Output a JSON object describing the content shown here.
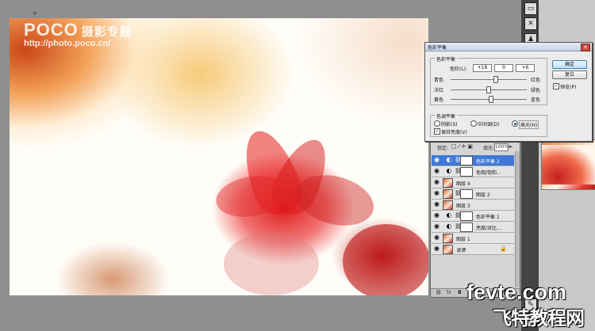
{
  "watermark": {
    "logo": "POCO",
    "logo_cn": "摄影专题",
    "url": "http://photo.poco.cn/"
  },
  "dialog": {
    "title": "色彩平衡",
    "color_balance_group": "色彩平衡",
    "levels_label": "色阶(L):",
    "levels": [
      "+18",
      "0",
      "+6"
    ],
    "sliders": [
      {
        "left": "青色",
        "right": "红色",
        "value": 18
      },
      {
        "left": "洋红",
        "right": "绿色",
        "value": 0
      },
      {
        "left": "黄色",
        "right": "蓝色",
        "value": 6
      }
    ],
    "tone_group": "色调平衡",
    "tones": {
      "shadows": "阴影(S)",
      "midtones": "中间调(D)",
      "highlights": "高光(H)",
      "selected": "highlights"
    },
    "preserve_luminosity": "保持亮度(V)",
    "ok": "确定",
    "reset": "复位",
    "preview": "预览(P)"
  },
  "layers_panel": {
    "lock_label": "锁定:",
    "fill_label": "填充:",
    "fill_value": "100%",
    "layers": [
      {
        "name": "色彩平衡 2",
        "selected": true,
        "type": "adjustment"
      },
      {
        "name": "色相/饱和...",
        "selected": false,
        "type": "adjustment"
      },
      {
        "name": "图层 4",
        "selected": false,
        "type": "image"
      },
      {
        "name": "图层 2",
        "selected": false,
        "type": "image-mask"
      },
      {
        "name": "图层 3",
        "selected": false,
        "type": "image"
      },
      {
        "name": "色彩平衡 1",
        "selected": false,
        "type": "adjustment"
      },
      {
        "name": "亮度/对比...",
        "selected": false,
        "type": "adjustment"
      },
      {
        "name": "图层 1",
        "selected": false,
        "type": "image"
      },
      {
        "name": "背景",
        "selected": false,
        "type": "background"
      }
    ]
  },
  "branding": {
    "en": "fevte.com",
    "cn": "飞特教程网"
  },
  "colors": {
    "selection": "#3f78d6",
    "workspace": "#8f8f8f"
  }
}
